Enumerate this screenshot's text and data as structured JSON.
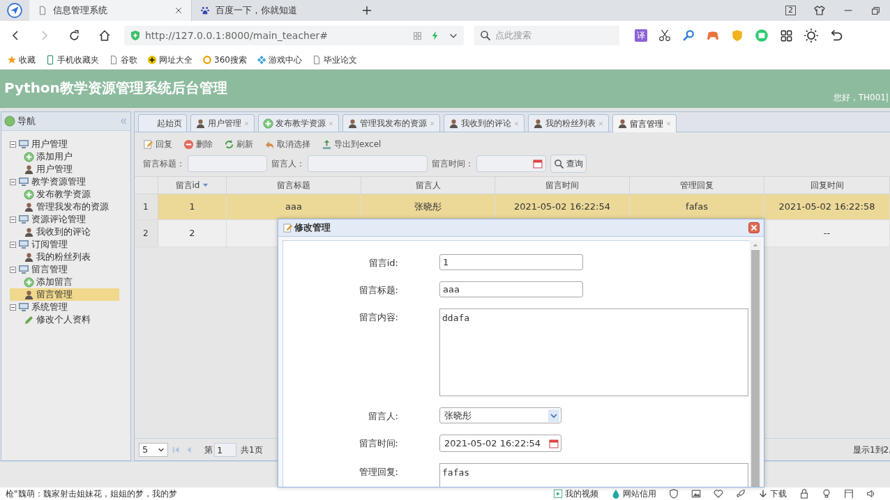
{
  "browser": {
    "tabs": [
      {
        "title": "信息管理系统",
        "kind": "page",
        "selected": true
      },
      {
        "title": "百度一下，你就知道",
        "kind": "paw",
        "selected": false
      }
    ],
    "tab_count": "2",
    "url": "http://127.0.0.1:8000/main_teacher#",
    "search_placeholder": "点此搜索",
    "translate": "译",
    "bookmarks": [
      {
        "label": "收藏",
        "kind": "star"
      },
      {
        "label": "手机收藏夹",
        "kind": "phone"
      },
      {
        "label": "谷歌",
        "kind": "page"
      },
      {
        "label": "网址大全",
        "kind": "plus"
      },
      {
        "label": "360搜索",
        "kind": "ring"
      },
      {
        "label": "游戏中心",
        "kind": "puzzle"
      },
      {
        "label": "毕业论文",
        "kind": "page"
      }
    ]
  },
  "header": {
    "title": "Python教学资源管理系统后台管理",
    "greeting": "您好，TH001|"
  },
  "sidebar": {
    "title": "导航",
    "tree": [
      {
        "label": "用户管理",
        "expanded": true,
        "children": [
          {
            "label": "添加用户",
            "kind": "add",
            "selected": false
          },
          {
            "label": "用户管理",
            "kind": "person",
            "selected": false
          }
        ]
      },
      {
        "label": "教学资源管理",
        "expanded": true,
        "children": [
          {
            "label": "发布教学资源",
            "kind": "add",
            "selected": false
          },
          {
            "label": "管理我发布的资源",
            "kind": "person",
            "selected": false
          }
        ]
      },
      {
        "label": "资源评论管理",
        "expanded": true,
        "children": [
          {
            "label": "我收到的评论",
            "kind": "person",
            "selected": false
          }
        ]
      },
      {
        "label": "订阅管理",
        "expanded": true,
        "children": [
          {
            "label": "我的粉丝列表",
            "kind": "person",
            "selected": false
          }
        ]
      },
      {
        "label": "留言管理",
        "expanded": true,
        "children": [
          {
            "label": "添加留言",
            "kind": "add",
            "selected": false
          },
          {
            "label": "留言管理",
            "kind": "person",
            "selected": true
          }
        ]
      },
      {
        "label": "系统管理",
        "expanded": true,
        "children": [
          {
            "label": "修改个人资料",
            "kind": "pencil",
            "selected": false
          }
        ]
      }
    ]
  },
  "tabs": [
    {
      "label": "起始页",
      "kind": "none",
      "closable": false,
      "selected": false
    },
    {
      "label": "用户管理",
      "kind": "person",
      "closable": true,
      "selected": false
    },
    {
      "label": "发布教学资源",
      "kind": "add",
      "closable": true,
      "selected": false
    },
    {
      "label": "管理我发布的资源",
      "kind": "person",
      "closable": true,
      "selected": false
    },
    {
      "label": "我收到的评论",
      "kind": "person",
      "closable": true,
      "selected": false
    },
    {
      "label": "我的粉丝列表",
      "kind": "person",
      "closable": true,
      "selected": false
    },
    {
      "label": "留言管理",
      "kind": "person",
      "closable": true,
      "selected": true
    }
  ],
  "toolbar": [
    {
      "label": "回复",
      "kind": "edit"
    },
    {
      "label": "删除",
      "kind": "remove"
    },
    {
      "label": "刷新",
      "kind": "refresh"
    },
    {
      "label": "取消选择",
      "kind": "undo"
    },
    {
      "label": "导出到excel",
      "kind": "export"
    }
  ],
  "filters": [
    {
      "label": "留言标题：",
      "kind": "text"
    },
    {
      "label": "留言人：",
      "kind": "text"
    },
    {
      "label": "留言时间：",
      "kind": "date"
    }
  ],
  "query_button": "查询",
  "table": {
    "columns": [
      {
        "label": "留言id",
        "sorted": true
      },
      {
        "label": "留言标题",
        "sorted": false
      },
      {
        "label": "留言人",
        "sorted": false
      },
      {
        "label": "留言时间",
        "sorted": false
      },
      {
        "label": "管理回复",
        "sorted": false
      },
      {
        "label": "回复时间",
        "sorted": false
      }
    ],
    "rows": [
      {
        "number": "1",
        "selected": true,
        "cells": [
          "1",
          "aaa",
          "张晓彤",
          "2021-05-02 16:22:54",
          "fafas",
          "2021-05-02 16:22:58"
        ]
      },
      {
        "number": "2",
        "selected": false,
        "cells": [
          "2",
          null,
          null,
          null,
          null,
          "--"
        ]
      }
    ]
  },
  "pagination": {
    "page_size": "5",
    "page_prefix": "第",
    "page": "1",
    "total_pages": "共1页",
    "summary": "显示1到2,"
  },
  "dialog": {
    "title": "修改管理",
    "fields": [
      {
        "label": "留言id:",
        "kind": "text",
        "value": "1"
      },
      {
        "label": "留言标题:",
        "kind": "text",
        "value": "aaa"
      },
      {
        "label": "留言内容:",
        "kind": "textarea",
        "value": "ddafa"
      },
      {
        "label": "留言人:",
        "kind": "select",
        "value": "张晓彤"
      },
      {
        "label": "留言时间:",
        "kind": "date",
        "value": "2021-05-02 16:22:54"
      },
      {
        "label": "管理回复:",
        "kind": "textarea",
        "value": "fafas"
      }
    ]
  },
  "status_bar": {
    "news": "枪\"魏萌：魏家射击姐妹花，姐姐的梦，我的梦",
    "items": [
      {
        "label": "我的视频",
        "kind": "play"
      },
      {
        "label": "网站信用",
        "kind": "drop"
      },
      {
        "kind": "shield"
      },
      {
        "kind": "image"
      },
      {
        "kind": "heart"
      },
      {
        "kind": "rocket"
      },
      {
        "label": "下载",
        "kind": "down"
      },
      {
        "kind": "lock"
      },
      {
        "kind": "bulb"
      },
      {
        "kind": "window"
      },
      {
        "kind": "speaker"
      }
    ]
  }
}
